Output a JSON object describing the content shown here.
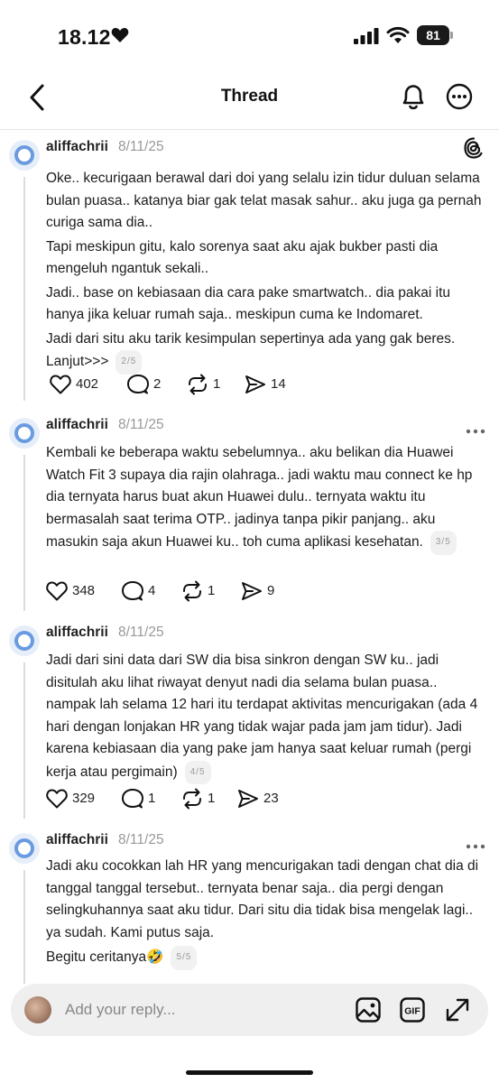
{
  "status": {
    "time": "18.12",
    "battery": "81"
  },
  "header": {
    "title": "Thread"
  },
  "posts": [
    {
      "username": "aliffachrii",
      "date": "8/11/25",
      "paragraphs": [
        "Oke.. kecurigaan berawal dari doi yang selalu izin tidur duluan selama bulan puasa.. katanya biar gak telat masak sahur.. aku juga ga pernah curiga sama dia..",
        "Tapi meskipun gitu, kalo sorenya saat aku ajak bukber pasti dia mengeluh ngantuk sekali..",
        "Jadi.. base on kebiasaan dia cara pake smartwatch.. dia pakai itu hanya jika keluar rumah saja.. meskipun cuma ke Indomaret.",
        "Jadi dari situ aku tarik kesimpulan sepertinya ada yang gak beres. Lanjut>>>"
      ],
      "pager": "2/5",
      "likes": "402",
      "comments": "2",
      "reposts": "1",
      "shares": "14"
    },
    {
      "username": "aliffachrii",
      "date": "8/11/25",
      "paragraphs": [
        "Kembali ke beberapa waktu sebelumnya.. aku belikan dia Huawei Watch Fit 3 supaya dia rajin olahraga.. jadi waktu mau connect ke hp dia ternyata harus buat akun Huawei dulu.. ternyata waktu itu bermasalah saat terima OTP.. jadinya tanpa pikir panjang.. aku masukin saja akun Huawei ku.. toh cuma aplikasi kesehatan."
      ],
      "pager": "3/5",
      "likes": "348",
      "comments": "4",
      "reposts": "1",
      "shares": "9"
    },
    {
      "username": "aliffachrii",
      "date": "8/11/25",
      "paragraphs": [
        "Jadi dari sini data dari SW dia bisa sinkron dengan SW ku.. jadi disitulah aku lihat riwayat denyut nadi dia selama bulan puasa.. nampak lah selama 12 hari itu terdapat aktivitas mencurigakan (ada 4 hari dengan lonjakan HR yang tidak wajar pada jam jam tidur). Jadi karena kebiasaan dia yang pake jam hanya saat keluar rumah (pergi kerja atau pergimain)"
      ],
      "pager": "4/5",
      "likes": "329",
      "comments": "1",
      "reposts": "1",
      "shares": "23"
    },
    {
      "username": "aliffachrii",
      "date": "8/11/25",
      "paragraphs": [
        "Jadi aku cocokkan lah HR yang mencurigakan tadi dengan chat dia di tanggal tanggal tersebut.. ternyata benar saja.. dia pergi dengan selingkuhannya saat aku tidur. Dari situ dia tidak bisa mengelak lagi.. ya sudah. Kami putus saja.",
        "Begitu ceritanya🤣"
      ],
      "pager": "5/5"
    }
  ],
  "reply": {
    "placeholder": "Add your reply..."
  },
  "icons": {
    "status": [
      "heart-icon",
      "signal-icon",
      "wifi-icon",
      "battery-icon"
    ],
    "header": [
      "back-icon",
      "bell-icon",
      "more-icon"
    ],
    "actions": [
      "like-icon",
      "comment-icon",
      "repost-icon",
      "share-icon"
    ],
    "reply": [
      "image-icon",
      "gif-icon",
      "expand-icon"
    ]
  },
  "colors": {
    "accent_avatar": "#6a9be0",
    "muted_text": "#999999",
    "reply_bar": "#efefef"
  }
}
